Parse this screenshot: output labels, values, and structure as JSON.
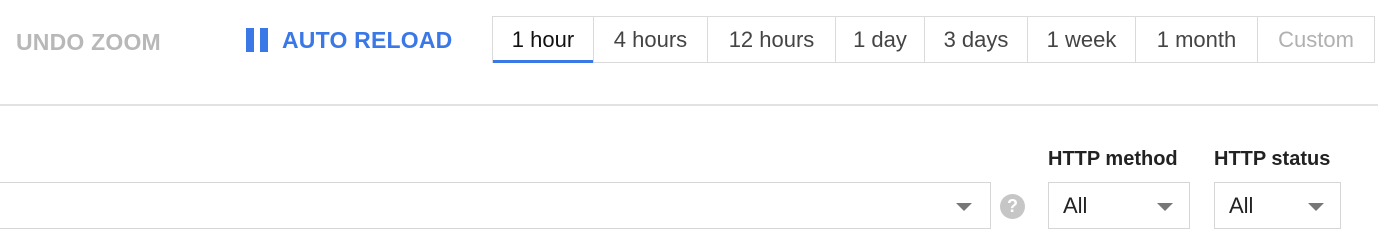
{
  "toolbar": {
    "undo_zoom_label": "UNDO ZOOM",
    "auto_reload_label": "AUTO RELOAD",
    "time_ranges": [
      {
        "label": "1 hour",
        "active": true
      },
      {
        "label": "4 hours"
      },
      {
        "label": "12 hours"
      },
      {
        "label": "1 day"
      },
      {
        "label": "3 days"
      },
      {
        "label": "1 week"
      },
      {
        "label": "1 month"
      },
      {
        "label": "Custom",
        "disabled": true
      }
    ]
  },
  "filters": {
    "search_value": "",
    "help_glyph": "?",
    "http_method": {
      "label": "HTTP method",
      "value": "All"
    },
    "http_status": {
      "label": "HTTP status",
      "value": "All"
    }
  },
  "colors": {
    "accent": "#3b78e7",
    "disabled_text": "#b8b8b8",
    "border": "#dadada"
  },
  "icons": {
    "pause": "pause-icon",
    "help": "help-icon",
    "dropdown": "chevron-down-icon"
  }
}
